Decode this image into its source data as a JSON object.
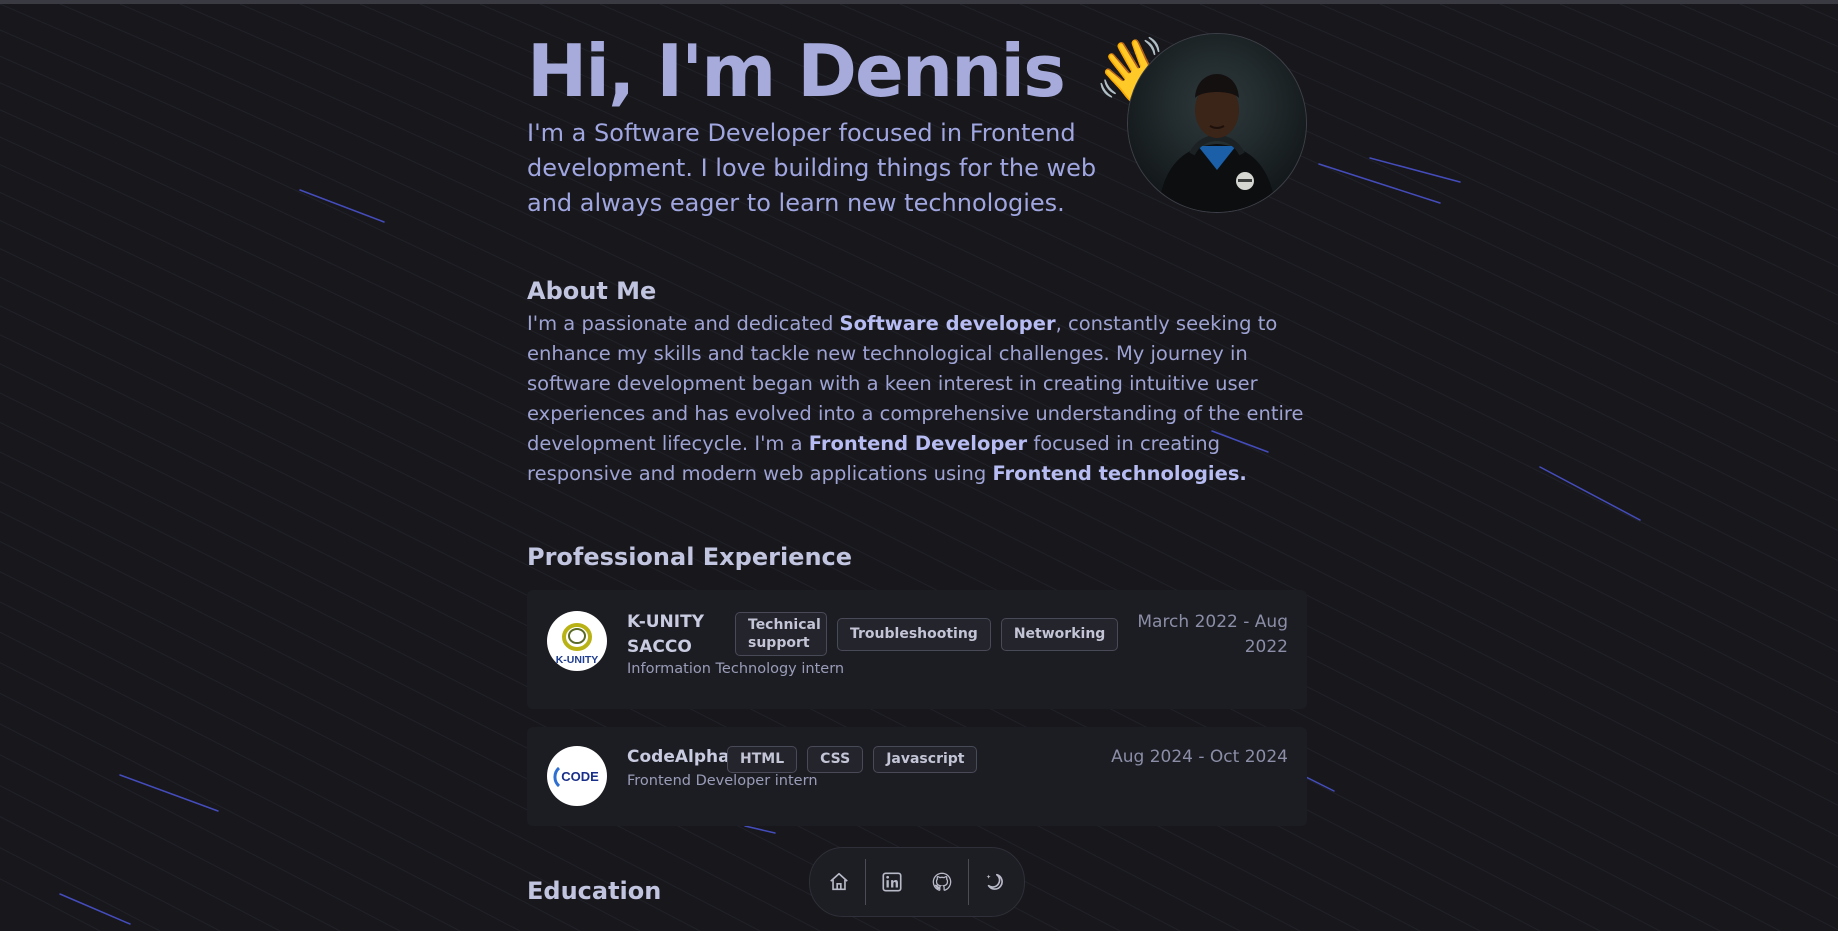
{
  "hero": {
    "name": "Hi, I'm Dennis",
    "wave_emoji": "👋",
    "intro": "I'm a Software Developer focused in Frontend development. I love building things for the web and always eager to learn new technologies."
  },
  "about": {
    "title": "About Me",
    "p1": "I'm a passionate and dedicated ",
    "b1": "Software developer",
    "p2": ", constantly seeking to enhance my skills and tackle new technological challenges. My journey in software development began with a keen interest in creating intuitive user experiences and has evolved into a comprehensive understanding of the entire development lifecycle. I'm a ",
    "b2": "Frontend Developer",
    "p3": " focused in creating responsive and modern web applications using ",
    "b3": "Frontend technologies."
  },
  "experience": {
    "title": "Professional Experience",
    "items": [
      {
        "company": "K-UNITY SACCO",
        "role": "Information Technology intern",
        "tags": [
          "Technical support",
          "Troubleshooting",
          "Networking"
        ],
        "date": "March 2022 - Aug 2022",
        "logo_text": "K-UNITY"
      },
      {
        "company": "CodeAlpha",
        "role": "Frontend Developer intern",
        "tags": [
          "HTML",
          "CSS",
          "Javascript"
        ],
        "date": "Aug 2024 - Oct 2024",
        "logo_text": "CODE"
      }
    ]
  },
  "education": {
    "title": "Education"
  },
  "dock": {
    "icons": [
      "home-icon",
      "linkedin-icon",
      "github-icon",
      "theme-toggle-icon"
    ]
  },
  "colors": {
    "background": "#17171c",
    "accent": "#a6abdc",
    "card": "#1c1c23",
    "streak": "#4d56d8"
  }
}
